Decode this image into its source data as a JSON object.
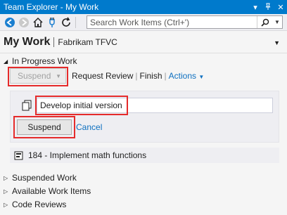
{
  "window": {
    "title": "Team Explorer - My Work",
    "pin_icon": "pin-icon",
    "close_icon": "close-icon",
    "dropdown_icon": "chevron-down-icon"
  },
  "toolbar": {
    "icons": [
      "back-icon",
      "forward-icon",
      "home-icon",
      "connect-icon",
      "refresh-icon"
    ],
    "search_placeholder": "Search Work Items (Ctrl+')"
  },
  "page": {
    "title": "My Work",
    "subtitle": "Fabrikam TFVC"
  },
  "in_progress": {
    "header": "In Progress Work",
    "suspend_dropdown_label": "Suspend",
    "actions": [
      "Request Review",
      "Finish"
    ],
    "actions_menu_label": "Actions",
    "comment_value": "Develop initial version",
    "suspend_button_label": "Suspend",
    "cancel_label": "Cancel",
    "work_item": "184 - Implement math functions"
  },
  "sections": [
    {
      "label": "Suspended Work"
    },
    {
      "label": "Available Work Items"
    },
    {
      "label": "Code Reviews"
    }
  ],
  "colors": {
    "accent": "#007acc",
    "link": "#0e70c0",
    "highlight": "#e52b2b"
  }
}
